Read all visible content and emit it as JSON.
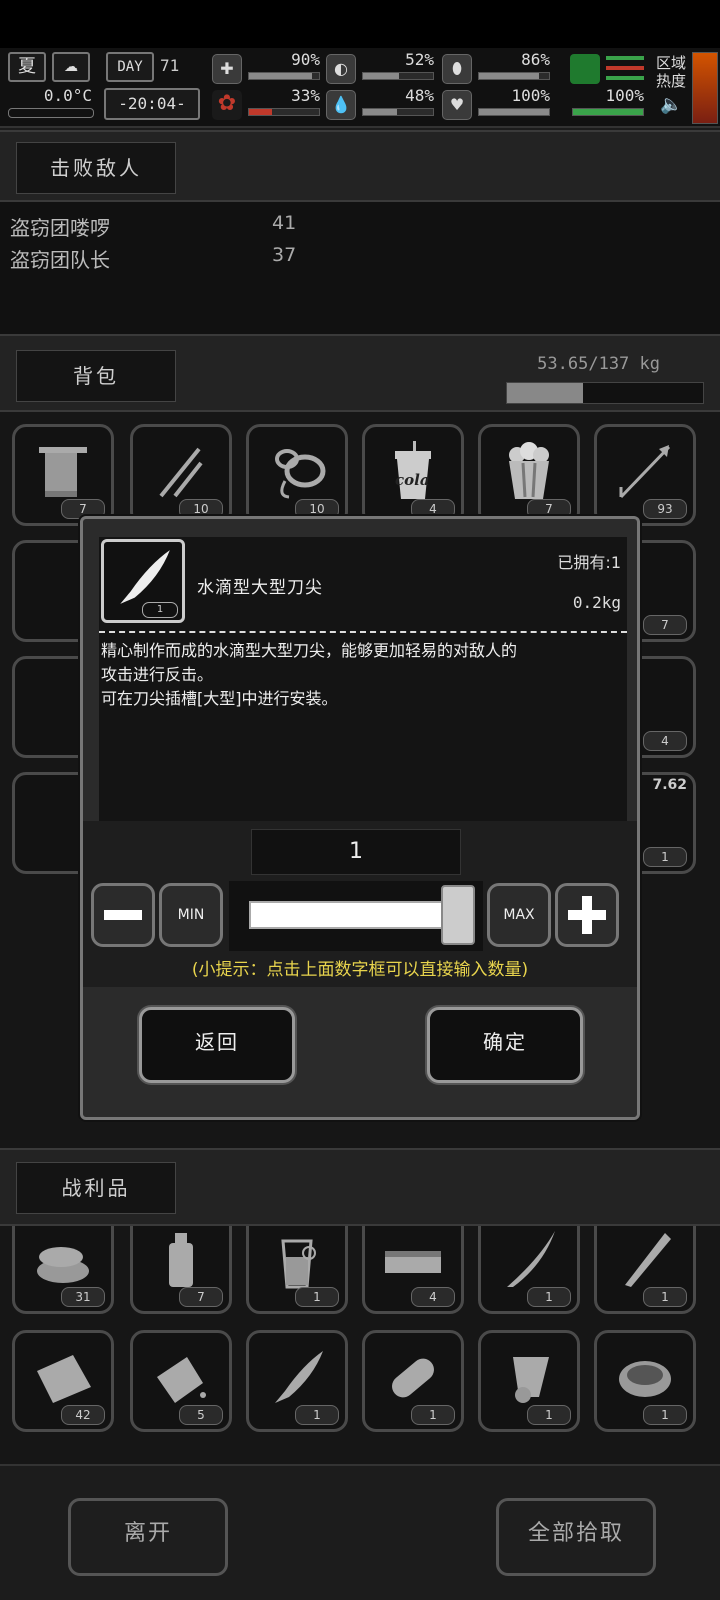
{
  "hud": {
    "season": "夏",
    "temperature": "0.0°C",
    "day_label": "DAY",
    "day_number": "71",
    "clock": "-20:04-",
    "stats": [
      {
        "name": "health",
        "value": "90%",
        "fraction": 0.9
      },
      {
        "name": "stomach",
        "value": "52%",
        "fraction": 0.52
      },
      {
        "name": "stamina",
        "value": "86%",
        "fraction": 0.86
      },
      {
        "name": "blood",
        "value": "33%",
        "fraction": 0.33
      },
      {
        "name": "water",
        "value": "48%",
        "fraction": 0.48
      },
      {
        "name": "mood",
        "value": "100%",
        "fraction": 1.0
      },
      {
        "name": "armor",
        "value": "100%",
        "fraction": 1.0
      }
    ],
    "zone_heat_label": "区域\n热度",
    "red_color": "#c0392b",
    "green_color": "#3aa34a"
  },
  "defeated": {
    "tab_label": "击败敌人",
    "rows": [
      {
        "name": "盗窃团喽啰",
        "count": "41"
      },
      {
        "name": "盗窃团队长",
        "count": "37"
      }
    ]
  },
  "backpack": {
    "tab_label": "背包",
    "weight": "53.65/137 kg",
    "weight_fraction": 0.39,
    "items": [
      {
        "icon": "towel-icon",
        "count": "7"
      },
      {
        "icon": "pliers-icon",
        "count": "10"
      },
      {
        "icon": "rope-icon",
        "count": "10"
      },
      {
        "icon": "cola-cup-icon",
        "count": "4",
        "text": "cola"
      },
      {
        "icon": "popcorn-icon",
        "count": "7"
      },
      {
        "icon": "arrow-icon",
        "count": "93"
      }
    ],
    "partial_counts": [
      "7",
      "4",
      "1",
      "7.62"
    ]
  },
  "modal": {
    "owned_label": "已拥有:1",
    "item_name": "水滴型大型刀尖",
    "weight": "0.2kg",
    "item_badge": "1",
    "description_line1": "精心制作而成的水滴型大型刀尖，能够更加轻易的对敌人的",
    "description_line2": "攻击进行反击。",
    "description_line3": "可在刀尖插槽[大型]中进行安装。",
    "quantity": "1",
    "min_label": "MIN",
    "max_label": "MAX",
    "slider_fraction": 1.0,
    "hint": "(小提示：点击上面数字框可以直接输入数量)",
    "hint_color": "#e8d44d",
    "back_label": "返回",
    "confirm_label": "确定"
  },
  "loot": {
    "tab_label": "战利品",
    "items": [
      {
        "icon": "cloth-pile-icon",
        "count": "31"
      },
      {
        "icon": "bottle-icon",
        "count": "7"
      },
      {
        "icon": "juice-cup-icon",
        "count": "1"
      },
      {
        "icon": "box-icon",
        "count": "4"
      },
      {
        "icon": "curved-blade-icon",
        "count": "1"
      },
      {
        "icon": "machete-icon",
        "count": "1"
      },
      {
        "icon": "fabric-icon",
        "count": "42"
      },
      {
        "icon": "scrap-icon",
        "count": "5"
      },
      {
        "icon": "blade-tip-icon",
        "count": "1"
      },
      {
        "icon": "bread-icon",
        "count": "1"
      },
      {
        "icon": "paper-roll-icon",
        "count": "1"
      },
      {
        "icon": "bowl-icon",
        "count": "1"
      }
    ]
  },
  "footer": {
    "leave_label": "离开",
    "take_all_label": "全部拾取"
  }
}
